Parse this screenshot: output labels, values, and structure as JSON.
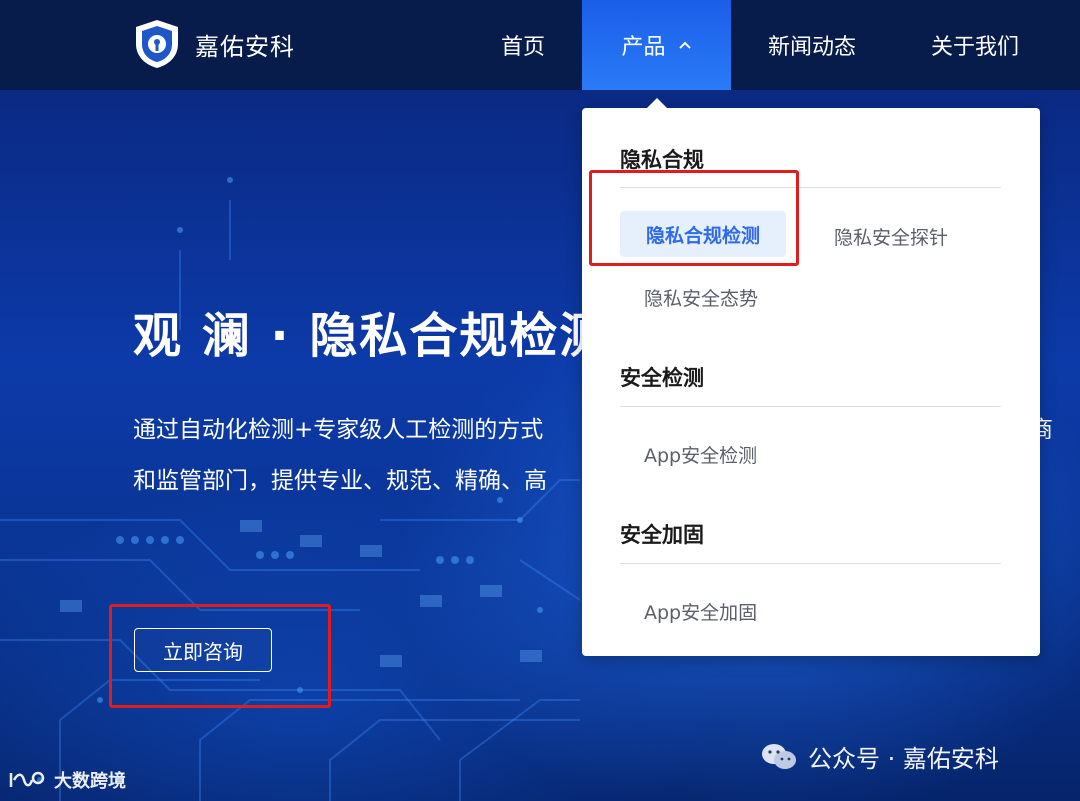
{
  "brand": {
    "name": "嘉佑安科"
  },
  "nav": {
    "home": "首页",
    "product": "产品",
    "news": "新闻动态",
    "about": "关于我们"
  },
  "hero": {
    "title": "观 澜 · 隐私合规检测",
    "desc_line1": "通过自动化检测+专家级人工检测的方式",
    "desc_tail": "商",
    "desc_line2": "和监管部门，提供专业、规范、精确、高",
    "cta": "立即咨询"
  },
  "dropdown": {
    "sections": [
      {
        "title": "隐私合规",
        "items": [
          "隐私合规检测",
          "隐私安全探针",
          "隐私安全态势"
        ],
        "active": "隐私合规检测"
      },
      {
        "title": "安全检测",
        "items": [
          "App安全检测"
        ]
      },
      {
        "title": "安全加固",
        "items": [
          "App安全加固"
        ]
      }
    ]
  },
  "watermark": {
    "left": "大数跨境",
    "right": "公众号 · 嘉佑安科"
  },
  "colors": {
    "nav_bg": "#071c4a",
    "nav_active": "#2a7bf7",
    "menu_active_text": "#2f6ae8",
    "menu_active_bg": "#e6effc",
    "highlight": "#e21b1b"
  }
}
